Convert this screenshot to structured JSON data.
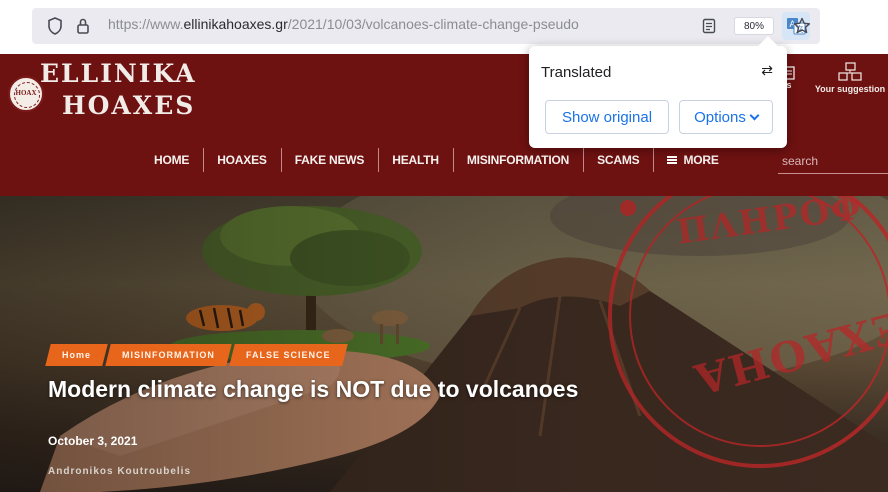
{
  "browser": {
    "url_prefix": "https://www.",
    "url_host": "ellinikahoaxes.gr",
    "url_path": "/2021/10/03/volcanoes-climate-change-pseudo",
    "zoom": "80%"
  },
  "translate_popup": {
    "title": "Translated",
    "show_original": "Show original",
    "options": "Options"
  },
  "site": {
    "logo_line1": "ELLINIKA",
    "logo_line2": "HOAXES",
    "logo_seal_text": "HOAX",
    "suggestions_label": "Your suggestion",
    "partial_label": "s",
    "search_placeholder": "search",
    "nav": [
      "HOME",
      "HOAXES",
      "FAKE NEWS",
      "HEALTH",
      "MISINFORMATION",
      "SCAMS",
      "MORE"
    ]
  },
  "article": {
    "breadcrumbs": [
      "Home",
      "MISINFORMATION",
      "FALSE SCIENCE"
    ],
    "title": "Modern climate change is NOT due to volcanoes",
    "date": "October 3, 2021",
    "author": "Andronikos Koutroubelis"
  },
  "stamp_text": "ΠΛΗΡΟΦ · SEXAOHA · GR",
  "colors": {
    "header_bg": "#6e1111",
    "accent_orange": "#e8651c",
    "link_blue": "#1a73e8"
  }
}
